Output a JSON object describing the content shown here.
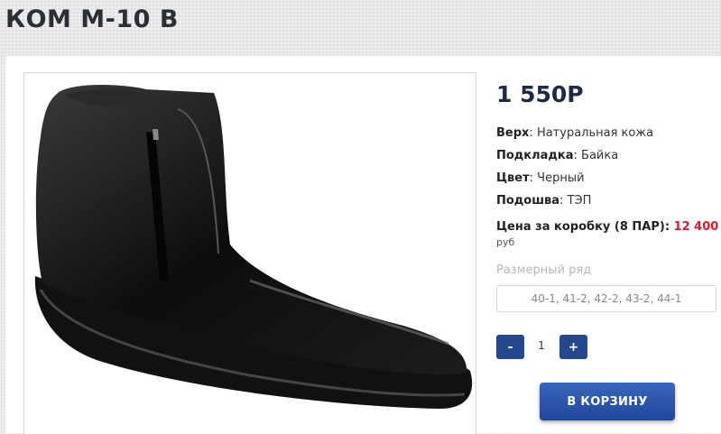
{
  "product": {
    "title": "КОМ М-10 В",
    "price": "1 550Р",
    "image_alt": "boot-image"
  },
  "specs": [
    {
      "label": "Верх",
      "value": "Натуральная кожа"
    },
    {
      "label": "Подкладка",
      "value": "Байка"
    },
    {
      "label": "Цвет",
      "value": "Черный"
    },
    {
      "label": "Подошва",
      "value": "ТЭП"
    }
  ],
  "box_price": {
    "label": "Цена за коробку (8 ПАР):",
    "value": "12 400",
    "currency": "руб"
  },
  "sizes": {
    "label": "Размерный ряд",
    "value": "40-1, 41-2, 42-2, 43-2, 44-1"
  },
  "quantity": {
    "minus": "-",
    "value": "1",
    "plus": "+"
  },
  "cart_button": "В КОРЗИНУ",
  "colors": {
    "accent": "#24478e",
    "price_red": "#d4202c"
  }
}
